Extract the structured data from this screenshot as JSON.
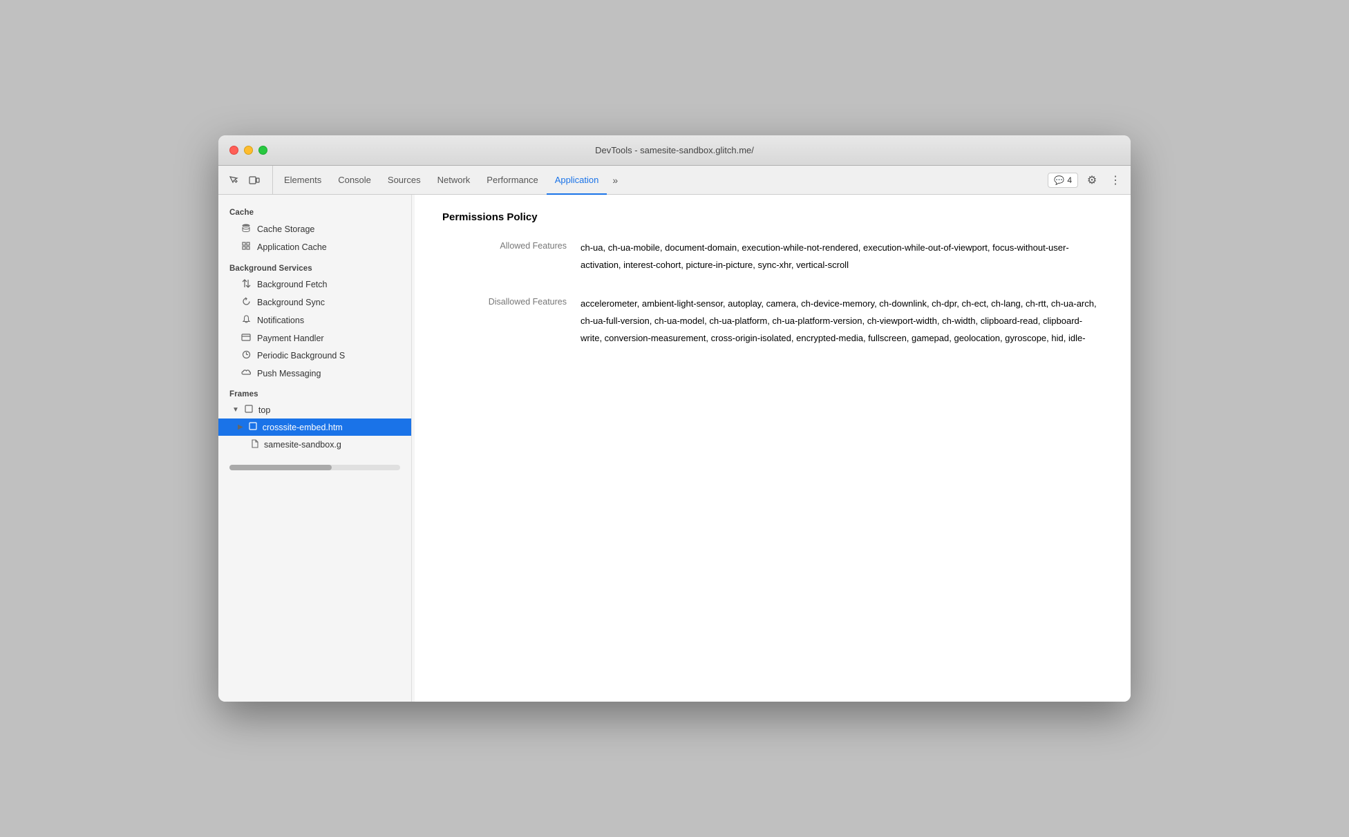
{
  "window": {
    "title": "DevTools - samesite-sandbox.glitch.me/"
  },
  "toolbar": {
    "tabs": [
      {
        "id": "elements",
        "label": "Elements",
        "active": false
      },
      {
        "id": "console",
        "label": "Console",
        "active": false
      },
      {
        "id": "sources",
        "label": "Sources",
        "active": false
      },
      {
        "id": "network",
        "label": "Network",
        "active": false
      },
      {
        "id": "performance",
        "label": "Performance",
        "active": false
      },
      {
        "id": "application",
        "label": "Application",
        "active": true
      }
    ],
    "badge_count": "4",
    "more_tabs_symbol": "»"
  },
  "sidebar": {
    "cache_label": "Cache",
    "cache_storage_label": "Cache Storage",
    "application_cache_label": "Application Cache",
    "background_services_label": "Background Services",
    "background_fetch_label": "Background Fetch",
    "background_sync_label": "Background Sync",
    "notifications_label": "Notifications",
    "payment_handler_label": "Payment Handler",
    "periodic_background_label": "Periodic Background S",
    "push_messaging_label": "Push Messaging",
    "frames_label": "Frames",
    "top_label": "top",
    "crosssite_label": "crosssite-embed.htm",
    "samesite_label": "samesite-sandbox.g"
  },
  "panel": {
    "title": "Permissions Policy",
    "allowed_features_label": "Allowed Features",
    "allowed_features_value": "ch-ua, ch-ua-mobile, document-domain, execution-while-not-rendered, execution-while-out-of-viewport, focus-without-user-activation, interest-cohort, picture-in-picture, sync-xhr, vertical-scroll",
    "disallowed_features_label": "Disallowed Features",
    "disallowed_features_value": "accelerometer, ambient-light-sensor, autoplay, camera, ch-device-memory, ch-downlink, ch-dpr, ch-ect, ch-lang, ch-rtt, ch-ua-arch, ch-ua-full-version, ch-ua-model, ch-ua-platform, ch-ua-platform-version, ch-viewport-width, ch-width, clipboard-read, clipboard-write, conversion-measurement, cross-origin-isolated, encrypted-media, fullscreen, gamepad, geolocation, gyroscope, hid, idle-"
  }
}
